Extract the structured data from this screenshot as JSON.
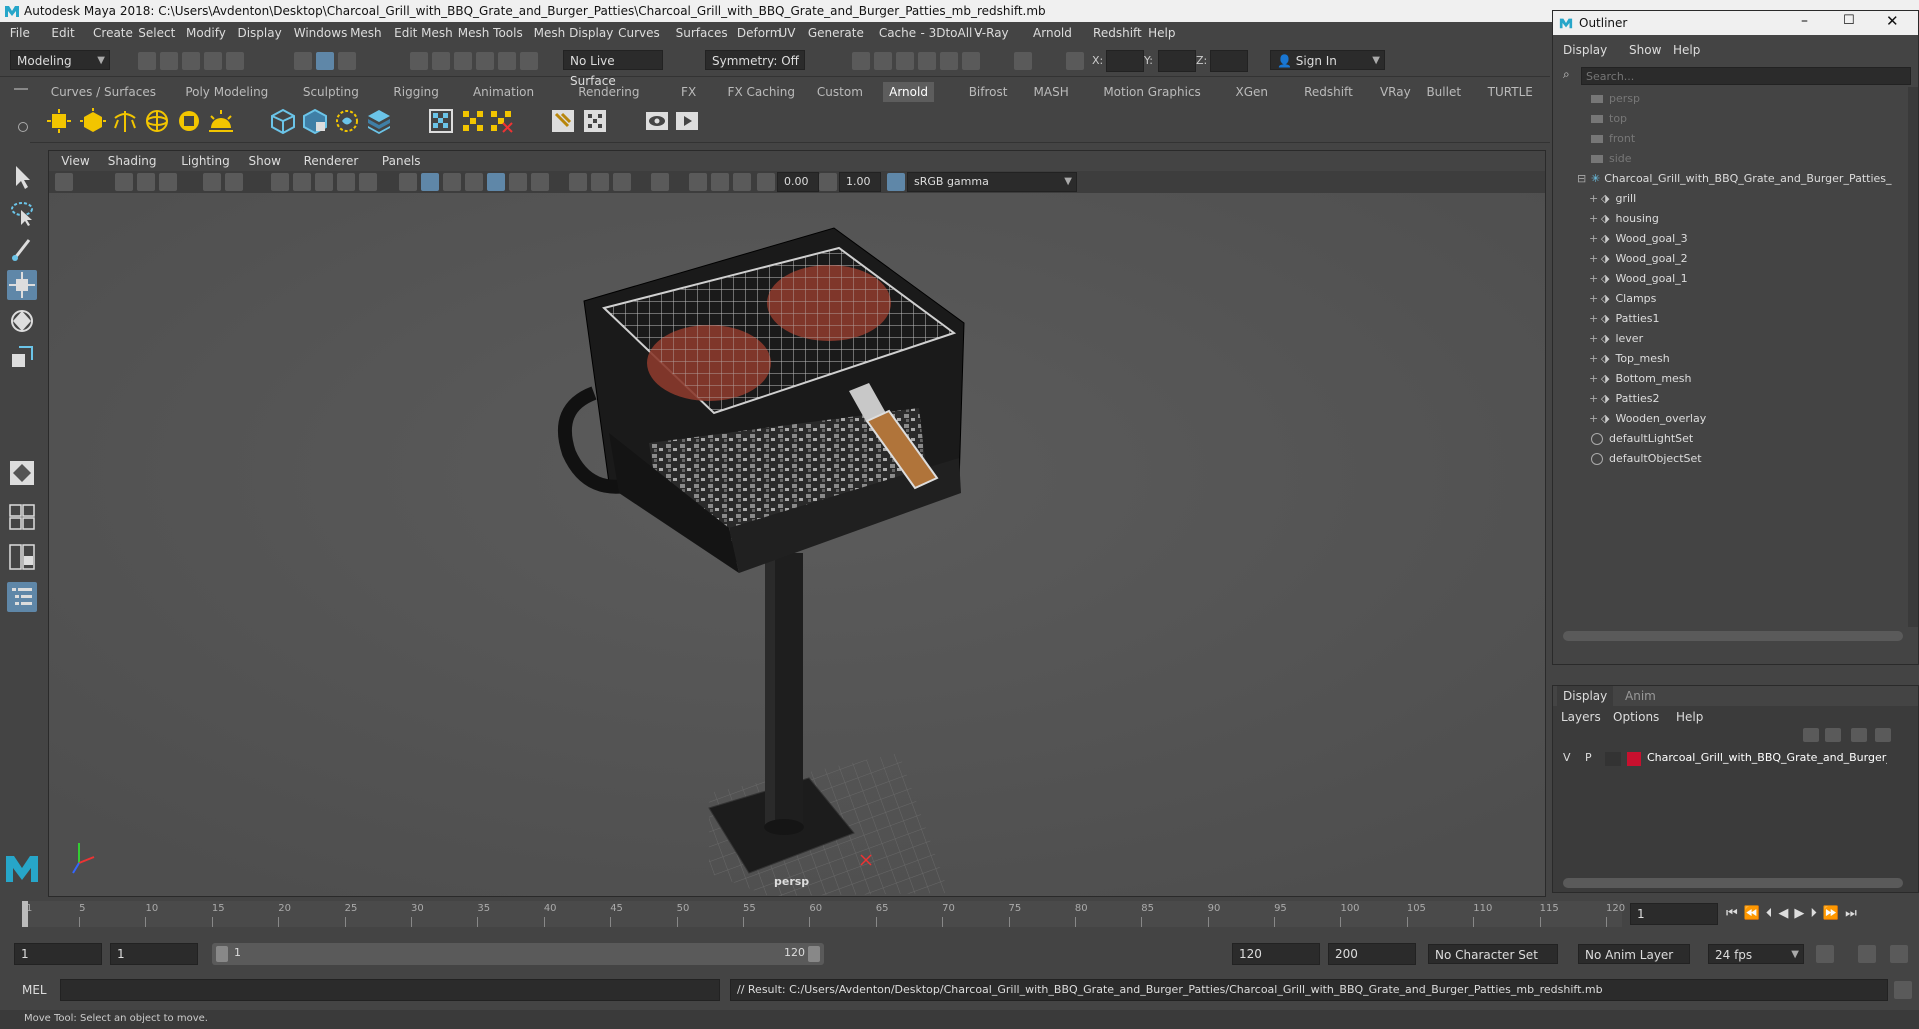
{
  "window": {
    "title": "Autodesk Maya 2018: C:\\Users\\Avdenton\\Desktop\\Charcoal_Grill_with_BBQ_Grate_and_Burger_Patties\\Charcoal_Grill_with_BBQ_Grate_and_Burger_Patties_mb_redshift.mb"
  },
  "menubar": [
    "File",
    "Edit",
    "Create",
    "Select",
    "Modify",
    "Display",
    "Windows",
    "Mesh",
    "Edit Mesh",
    "Mesh Tools",
    "Mesh Display",
    "Curves",
    "Surfaces",
    "Deform",
    "UV",
    "Generate",
    "Cache",
    "- 3DtoAll -",
    "V-Ray",
    "Arnold",
    "Redshift",
    "Help"
  ],
  "statusline": {
    "mode": "Modeling",
    "live_surface": "No Live Surface",
    "symmetry": "Symmetry: Off",
    "x_label": "X:",
    "y_label": "Y:",
    "z_label": "Z:",
    "sign_in": "Sign In"
  },
  "shelf_tabs": [
    "Curves / Surfaces",
    "Poly Modeling",
    "Sculpting",
    "Rigging",
    "Animation",
    "Rendering",
    "FX",
    "FX Caching",
    "Custom",
    "Arnold",
    "Bifrost",
    "MASH",
    "Motion Graphics",
    "XGen",
    "Redshift",
    "VRay",
    "Bullet",
    "TURTLE"
  ],
  "active_shelf": "Arnold",
  "viewport": {
    "menus": [
      "View",
      "Shading",
      "Lighting",
      "Show",
      "Renderer",
      "Panels"
    ],
    "exposure": "0.00",
    "gamma": "1.00",
    "color_space": "sRGB gamma",
    "camera": "persp"
  },
  "outliner": {
    "title": "Outliner",
    "menus": [
      "Display",
      "Show",
      "Help"
    ],
    "search_placeholder": "Search...",
    "cameras": [
      "persp",
      "top",
      "front",
      "side"
    ],
    "root": "Charcoal_Grill_with_BBQ_Grate_and_Burger_Patties_",
    "children": [
      "grill",
      "housing",
      "Wood_goal_3",
      "Wood_goal_2",
      "Wood_goal_1",
      "Clamps",
      "Patties1",
      "lever",
      "Top_mesh",
      "Bottom_mesh",
      "Patties2",
      "Wooden_overlay"
    ],
    "sets": [
      "defaultLightSet",
      "defaultObjectSet"
    ]
  },
  "layer_editor": {
    "tabs": [
      "Display",
      "Anim"
    ],
    "menus": [
      "Layers",
      "Options",
      "Help"
    ],
    "layer": {
      "v": "V",
      "p": "P",
      "name": "Charcoal_Grill_with_BBQ_Grate_and_Burger_Patties",
      "color": "#c8102e"
    }
  },
  "timeline": {
    "ticks": [
      "1",
      "5",
      "10",
      "15",
      "20",
      "25",
      "30",
      "35",
      "40",
      "45",
      "50",
      "55",
      "60",
      "65",
      "70",
      "75",
      "80",
      "85",
      "90",
      "95",
      "100",
      "105",
      "110",
      "115",
      "120"
    ],
    "current_frame": "1"
  },
  "range": {
    "start": "1",
    "playback_start": "1",
    "slider_start": "1",
    "slider_end": "120",
    "playback_end": "120",
    "end": "200",
    "character_set": "No Character Set",
    "anim_layer": "No Anim Layer",
    "fps": "24 fps"
  },
  "command": {
    "lang": "MEL",
    "result": "// Result: C:/Users/Avdenton/Desktop/Charcoal_Grill_with_BBQ_Grate_and_Burger_Patties/Charcoal_Grill_with_BBQ_Grate_and_Burger_Patties_mb_redshift.mb"
  },
  "help": "Move Tool: Select an object to move.",
  "colors": {
    "accent": "#5f87a8",
    "maya_logo": "#27a6c9"
  }
}
